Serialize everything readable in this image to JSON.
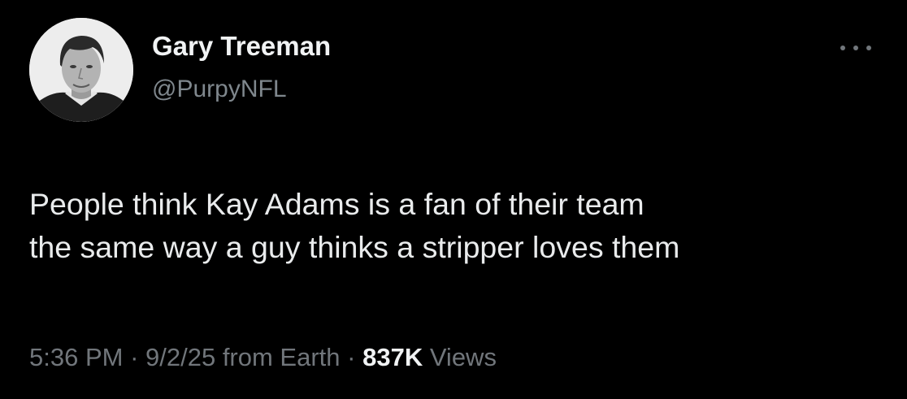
{
  "theme": {
    "background": "#000000",
    "text_primary": "#e7e9ea",
    "text_secondary": "#71767b"
  },
  "author": {
    "display_name": "Gary Treeman",
    "handle": "@PurpyNFL",
    "avatar_icon": "profile-photo"
  },
  "more_icon": "ellipsis-icon",
  "tweet": {
    "lines": [
      "People think Kay Adams is a fan of their team",
      "the same way a guy thinks a stripper loves them"
    ]
  },
  "meta": {
    "time": "5:36 PM",
    "separator_1": " · ",
    "date_source": "9/2/25 from Earth",
    "separator_2": " · ",
    "views_count": "837K",
    "views_label": " Views"
  }
}
